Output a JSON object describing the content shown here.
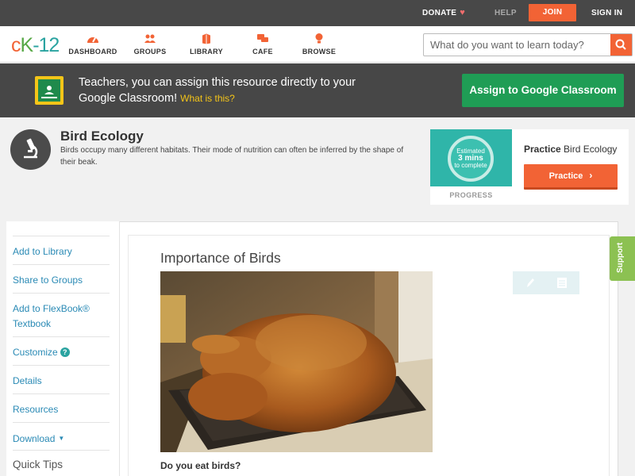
{
  "topbar": {
    "donate": "DONATE",
    "help": "HELP",
    "join": "JOIN",
    "signin": "SIGN IN"
  },
  "logo": {
    "c": "c",
    "k": "K",
    "n": "-12"
  },
  "nav": {
    "items": [
      {
        "label": "DASHBOARD",
        "icon": "dashboard-icon"
      },
      {
        "label": "GROUPS",
        "icon": "groups-icon"
      },
      {
        "label": "LIBRARY",
        "icon": "library-icon"
      },
      {
        "label": "CAFE",
        "icon": "cafe-icon"
      },
      {
        "label": "BROWSE",
        "icon": "browse-icon"
      }
    ],
    "search_placeholder": "What do you want to learn today?"
  },
  "banner": {
    "text": "Teachers, you can assign this resource directly to your Google Classroom!",
    "whatis": "What is this?",
    "button": "Assign to Google Classroom"
  },
  "concept": {
    "title": "Bird Ecology",
    "description": "Birds occupy many different habitats. Their mode of nutrition can often be inferred by the shape of their beak."
  },
  "practice": {
    "estimated": "Estimated",
    "mins": "3 mins",
    "to_complete": "to complete",
    "progress_label": "PROGRESS",
    "title_prefix": "Practice",
    "title_subject": "Bird Ecology",
    "button": "Practice"
  },
  "sidebar": {
    "add_library": "Add to Library",
    "share_groups": "Share to Groups",
    "add_flexbook": "Add to FlexBook® Textbook",
    "customize": "Customize",
    "details": "Details",
    "resources": "Resources",
    "download": "Download",
    "quick_tips": "Quick Tips"
  },
  "article": {
    "title": "Importance of Birds",
    "question": "Do you eat birds?"
  },
  "support": "Support",
  "colors": {
    "accent_orange": "#f26335",
    "google_green": "#1f9d55",
    "teal": "#2aa3a0",
    "support_green": "#8cc152"
  }
}
